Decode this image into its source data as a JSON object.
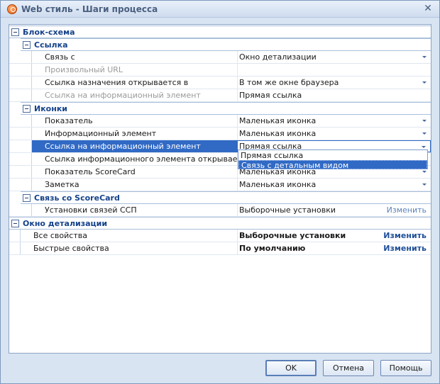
{
  "window": {
    "title": "Web стиль - Шаги процесса"
  },
  "sections": {
    "flowchart": "Блок-схема",
    "link": "Ссылка",
    "icons": "Иконки",
    "scorecard": "Связь со ScoreCard",
    "drill": "Окно детализации"
  },
  "link_props": [
    {
      "name": "Связь с",
      "value": "Окно детализации"
    },
    {
      "name": "Произвольный URL",
      "value": ""
    },
    {
      "name": "Ссылка назначения открывается в",
      "value": "В том же окне браузера"
    },
    {
      "name": "Ссылка на информационный элемент",
      "value": "Прямая ссылка"
    }
  ],
  "icon_props": [
    {
      "name": "Показатель",
      "value": "Маленькая иконка"
    },
    {
      "name": "Информационный элемент",
      "value": "Маленькая иконка"
    },
    {
      "name": "Ссылка на информационный элемент",
      "value": "Прямая ссылка"
    },
    {
      "name": "Ссылка информационного элемента открывается в",
      "value": ""
    },
    {
      "name": "Показатель ScoreCard",
      "value": "Маленькая иконка"
    },
    {
      "name": "Заметка",
      "value": "Маленькая иконка"
    }
  ],
  "dropdown_options": [
    "Прямая ссылка",
    "Связь с детальным видом"
  ],
  "scorecard_props": [
    {
      "name": "Установки связей ССП",
      "value": "Выборочные установки",
      "action": "Изменить"
    }
  ],
  "drill_props": [
    {
      "name": "Все свойства",
      "value": "Выборочные установки",
      "action": "Изменить"
    },
    {
      "name": "Быстрые свойства",
      "value": "По умолчанию",
      "action": "Изменить"
    }
  ],
  "buttons": {
    "ok": "OK",
    "cancel": "Отмена",
    "help": "Помощь"
  },
  "icons": {
    "app": "app-logo-icon",
    "close": "close-icon",
    "collapse": "collapse-icon",
    "dropdown": "chevron-down-icon"
  },
  "colors": {
    "accent": "#316ac5",
    "section_text": "#15428b",
    "link": "#1f4f99"
  }
}
